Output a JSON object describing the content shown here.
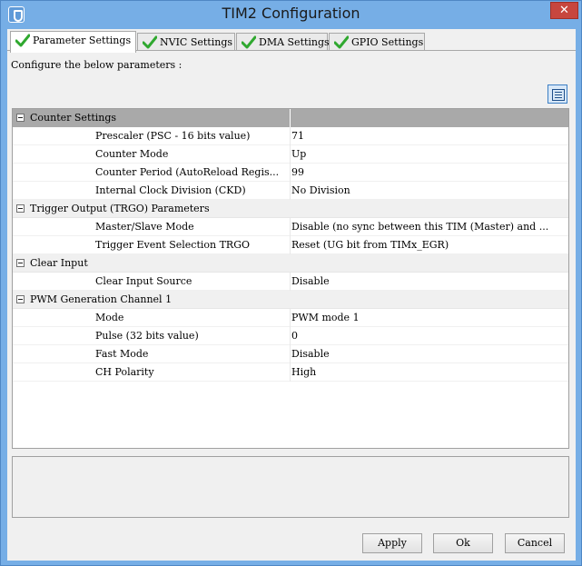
{
  "window": {
    "title": "TIM2 Configuration",
    "close_glyph": "✕"
  },
  "tabs": [
    {
      "label": "Parameter Settings",
      "active": true,
      "icon": "check-icon"
    },
    {
      "label": "NVIC Settings",
      "active": false,
      "icon": "check-icon"
    },
    {
      "label": "DMA Settings",
      "active": false,
      "icon": "check-icon"
    },
    {
      "label": "GPIO Settings",
      "active": false,
      "icon": "check-icon"
    }
  ],
  "panel": {
    "instructions": "Configure the below parameters :",
    "groups": [
      {
        "name": "Counter Settings",
        "header": true,
        "items": [
          {
            "label": "Prescaler (PSC - 16 bits value)",
            "value": "71"
          },
          {
            "label": "Counter Mode",
            "value": "Up"
          },
          {
            "label": "Counter Period (AutoReload Regis...",
            "value": "99"
          },
          {
            "label": "Internal Clock Division (CKD)",
            "value": "No Division"
          }
        ]
      },
      {
        "name": "Trigger Output (TRGO) Parameters",
        "items": [
          {
            "label": "Master/Slave Mode",
            "value": "Disable (no sync between this TIM (Master) and ..."
          },
          {
            "label": "Trigger Event Selection TRGO",
            "value": "Reset (UG bit from TIMx_EGR)"
          }
        ]
      },
      {
        "name": "Clear Input",
        "items": [
          {
            "label": "Clear Input Source",
            "value": "Disable"
          }
        ]
      },
      {
        "name": "PWM Generation Channel 1",
        "items": [
          {
            "label": "Mode",
            "value": "PWM mode 1"
          },
          {
            "label": "Pulse (32 bits value)",
            "value": "0"
          },
          {
            "label": "Fast Mode",
            "value": "Disable"
          },
          {
            "label": "CH Polarity",
            "value": "High"
          }
        ]
      }
    ]
  },
  "buttons": {
    "apply": "Apply",
    "ok": "Ok",
    "cancel": "Cancel"
  },
  "colors": {
    "window_frame": "#76aee6",
    "close": "#c7463e",
    "check": "#2fa82f",
    "header_row": "#a9a9a9"
  }
}
